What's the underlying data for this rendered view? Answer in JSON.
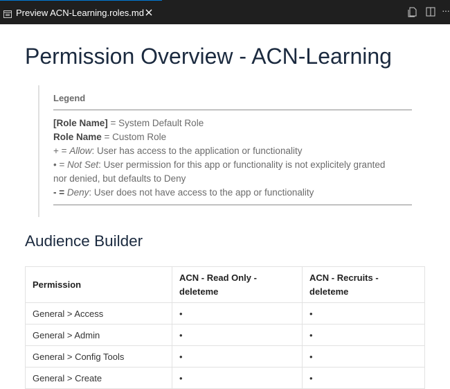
{
  "tab": {
    "title": "Preview ACN-Learning.roles.md"
  },
  "document": {
    "title": "Permission Overview - ACN-Learning",
    "legend": {
      "heading": "Legend",
      "lines": [
        {
          "key": "[Role Name]",
          "text": " = System Default Role"
        },
        {
          "key": "Role Name",
          "text": " = Custom Role"
        },
        {
          "symbol": "+ = ",
          "term": "Allow",
          "text": ": User has access to the application or functionality"
        },
        {
          "symbol": "• = ",
          "term": "Not Set",
          "text": ": User permission for this app or functionality is not explicitely granted"
        },
        {
          "text": "nor denied, but defaults to Deny"
        },
        {
          "symbol": "- = ",
          "term": "Deny",
          "text": ": User does not have access to the app or functionality"
        }
      ]
    },
    "section": {
      "heading": "Audience Builder",
      "table": {
        "headers": [
          "Permission",
          "ACN - Read Only - deleteme",
          "ACN - Recruits - deleteme"
        ],
        "rows": [
          [
            "General > Access",
            "•",
            "•"
          ],
          [
            "General > Admin",
            "•",
            "•"
          ],
          [
            "General > Config Tools",
            "•",
            "•"
          ],
          [
            "General > Create",
            "•",
            "•"
          ]
        ]
      }
    }
  },
  "colors": {
    "tabbar_bg": "#1f1f1f",
    "tab_active_border": "#0078d4",
    "heading": "#1b2a3f"
  },
  "icons": [
    "preview-icon",
    "close-icon",
    "open-source-icon",
    "split-editor-icon",
    "more-actions-icon"
  ]
}
